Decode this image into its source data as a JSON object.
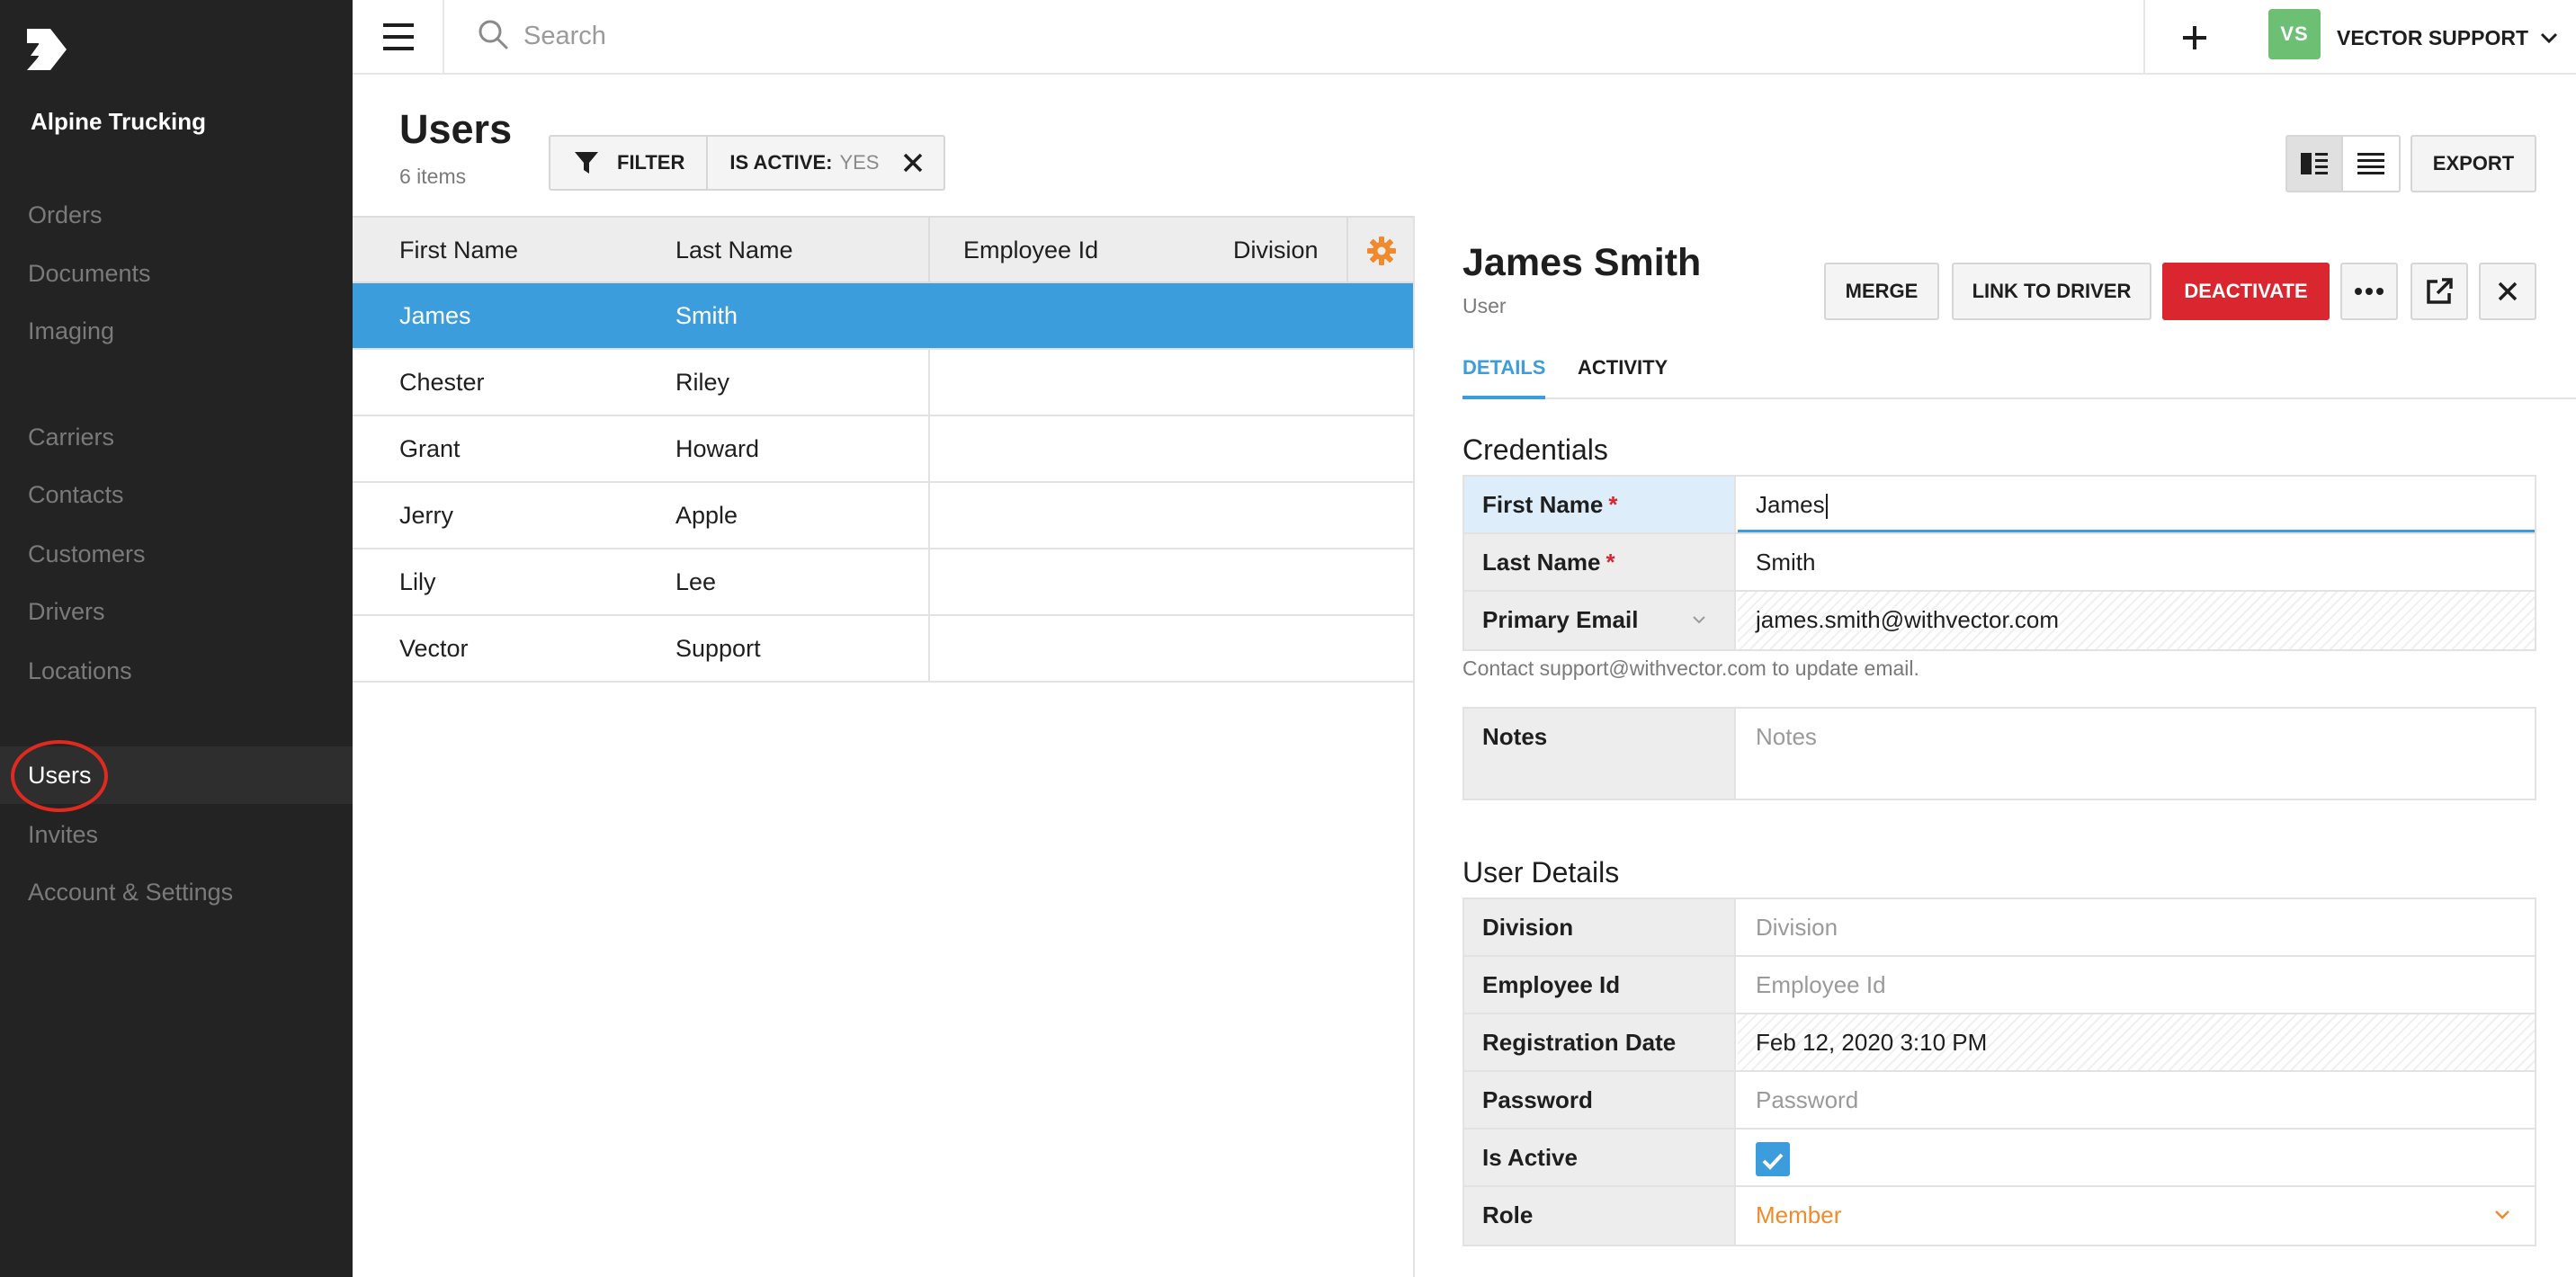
{
  "sidebar": {
    "company": "Alpine Trucking",
    "items": [
      {
        "label": "Orders"
      },
      {
        "label": "Documents"
      },
      {
        "label": "Imaging"
      },
      {
        "label": "Carriers"
      },
      {
        "label": "Contacts"
      },
      {
        "label": "Customers"
      },
      {
        "label": "Drivers"
      },
      {
        "label": "Locations"
      },
      {
        "label": "Users",
        "active": true
      },
      {
        "label": "Invites"
      },
      {
        "label": "Account & Settings"
      }
    ]
  },
  "topbar": {
    "search_placeholder": "Search",
    "avatar_initials": "VS",
    "user_name": "VECTOR SUPPORT",
    "avatar_color": "#6dbf74"
  },
  "page": {
    "title": "Users",
    "count": "6 items",
    "filter_label": "FILTER",
    "filter_chip_key": "IS ACTIVE:",
    "filter_chip_value": "YES",
    "export_label": "EXPORT"
  },
  "table": {
    "columns": [
      "First Name",
      "Last Name",
      "Employee Id",
      "Division"
    ],
    "rows": [
      {
        "first": "James",
        "last": "Smith",
        "selected": true
      },
      {
        "first": "Chester",
        "last": "Riley"
      },
      {
        "first": "Grant",
        "last": "Howard"
      },
      {
        "first": "Jerry",
        "last": "Apple"
      },
      {
        "first": "Lily",
        "last": "Lee"
      },
      {
        "first": "Vector",
        "last": "Support"
      }
    ],
    "selected_color": "#3c9ddc",
    "gear_color": "#f08a2c"
  },
  "detail": {
    "name": "James Smith",
    "type": "User",
    "merge_label": "MERGE",
    "link_label": "LINK TO DRIVER",
    "deactivate_label": "DEACTIVATE",
    "deactivate_color": "#d9262f",
    "tabs": [
      {
        "label": "DETAILS",
        "active": true
      },
      {
        "label": "ACTIVITY"
      }
    ],
    "credentials": {
      "title": "Credentials",
      "first_name_label": "First Name",
      "first_name_value": "James",
      "last_name_label": "Last Name",
      "last_name_value": "Smith",
      "email_label": "Primary Email",
      "email_value": "james.smith@withvector.com",
      "required_mark": "*",
      "helper": "Contact support@withvector.com to update email.",
      "notes_label": "Notes",
      "notes_placeholder": "Notes"
    },
    "user_details": {
      "title": "User Details",
      "division_label": "Division",
      "division_placeholder": "Division",
      "employee_id_label": "Employee Id",
      "employee_id_placeholder": "Employee Id",
      "registration_label": "Registration Date",
      "registration_value": "Feb 12, 2020 3:10 PM",
      "password_label": "Password",
      "password_placeholder": "Password",
      "active_label": "Is Active",
      "is_active": true,
      "role_label": "Role",
      "role_value": "Member",
      "role_color": "#f08a2c"
    }
  }
}
